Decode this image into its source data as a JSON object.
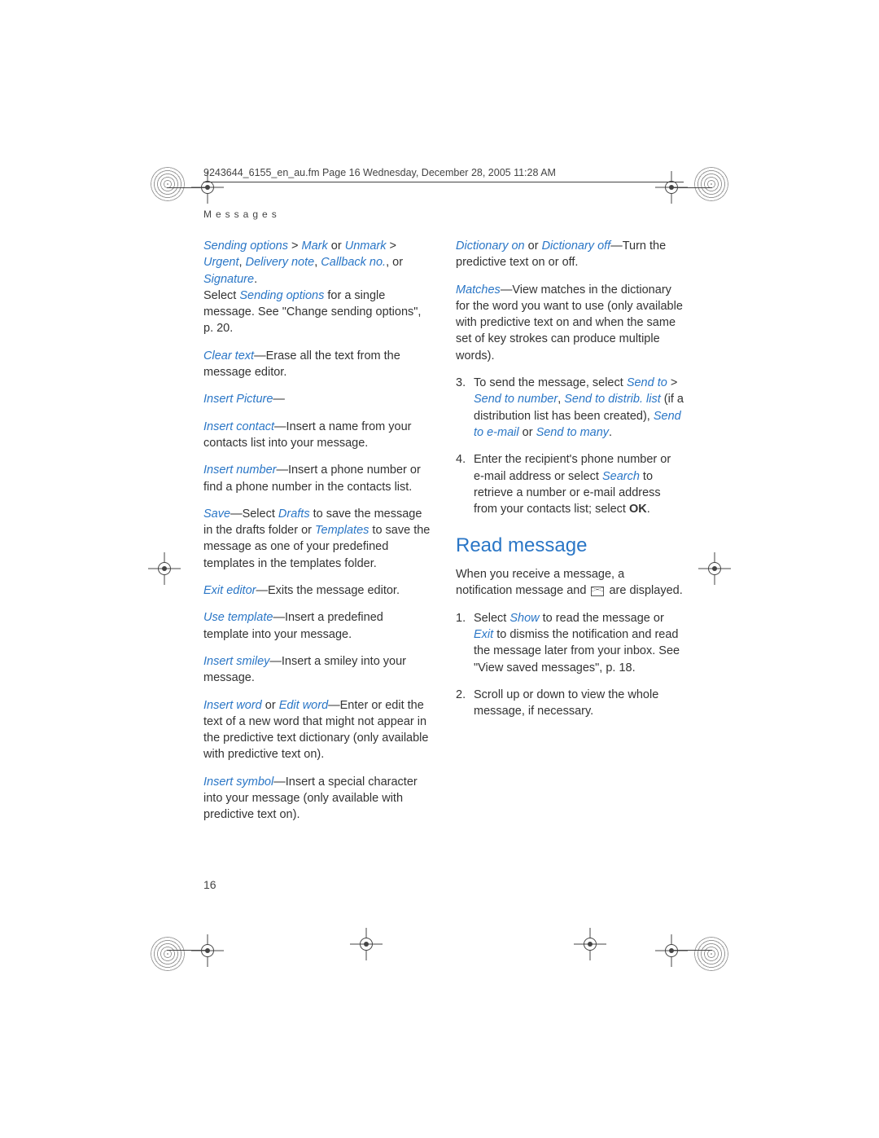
{
  "header": {
    "line": "9243644_6155_en_au.fm  Page 16  Wednesday, December 28, 2005  11:28 AM",
    "section": "Messages"
  },
  "left": {
    "p1": {
      "a": "Sending options",
      "b": " > ",
      "c": "Mark",
      "d": " or ",
      "e": "Unmark",
      "f": " > ",
      "g": "Urgent",
      "h": ", ",
      "i": "Delivery note",
      "j": ", ",
      "k": "Callback no.",
      "l": ", or ",
      "m": "Signature",
      "n": ".",
      "o": "Select ",
      "p": " Sending options",
      "q": " for a single message. See \"Change sending options\", p. 20."
    },
    "p2": {
      "a": "Clear text",
      "b": "—Erase all the text from the message editor."
    },
    "p3": {
      "a": "Insert Picture",
      "b": "—"
    },
    "p4": {
      "a": "Insert contact",
      "b": "—Insert a name from your contacts list into your message."
    },
    "p5": {
      "a": "Insert number",
      "b": "—Insert a phone number or find a phone number in the contacts list."
    },
    "p6": {
      "a": "Save",
      "b": "—Select ",
      "c": "Drafts",
      "d": " to save the message in the drafts folder or ",
      "e": "Templates",
      "f": " to save the message as one of your predefined templates in the templates folder."
    },
    "p7": {
      "a": "Exit editor",
      "b": "—Exits the message editor."
    },
    "p8": {
      "a": "Use template",
      "b": "—Insert a predefined template into your message."
    },
    "p9": {
      "a": "Insert smiley",
      "b": "—Insert a smiley into your message."
    },
    "p10": {
      "a": "Insert word",
      "b": " or ",
      "c": "Edit word",
      "d": "—Enter or edit the text of a new word that might not appear in the predictive text dictionary (only available with predictive text on)."
    },
    "p11": {
      "a": "Insert symbol",
      "b": "—Insert a special character into your message (only available with predictive text on)."
    }
  },
  "right": {
    "p1": {
      "a": "Dictionary on",
      "b": " or ",
      "c": "Dictionary off",
      "d": "—Turn the predictive text on or off."
    },
    "p2": {
      "a": "Matches",
      "b": "—View matches in the dictionary for the word you want to use (only available with predictive text on and when the same set of key strokes can produce multiple words)."
    },
    "li3": {
      "n": "3.",
      "a": "To send the message, select ",
      "b": "Send to",
      "c": " > ",
      "d": "Send to number",
      "e": ", ",
      "f": "Send to distrib. list",
      "g": " (if a distribution list has been created), ",
      "h": "Send to e-mail",
      "i": " or ",
      "j": "Send to many",
      "k": "."
    },
    "li4": {
      "n": "4.",
      "a": "Enter the recipient's phone number or e-mail address or select ",
      "b": "Search",
      "c": " to retrieve a number or e-mail address from your contacts list; select ",
      "d": "OK",
      "e": "."
    },
    "heading": "Read message",
    "intro": {
      "a": "When you receive a message, a notification message and ",
      "b": " are displayed."
    },
    "r1": {
      "n": "1.",
      "a": "Select ",
      "b": "Show",
      "c": " to read the message or ",
      "d": "Exit",
      "e": " to dismiss the notification and read the message later from your inbox. See \"View saved messages\", p. 18."
    },
    "r2": {
      "n": "2.",
      "a": "Scroll up or down to view the whole message, if necessary."
    }
  },
  "pagenum": "16"
}
